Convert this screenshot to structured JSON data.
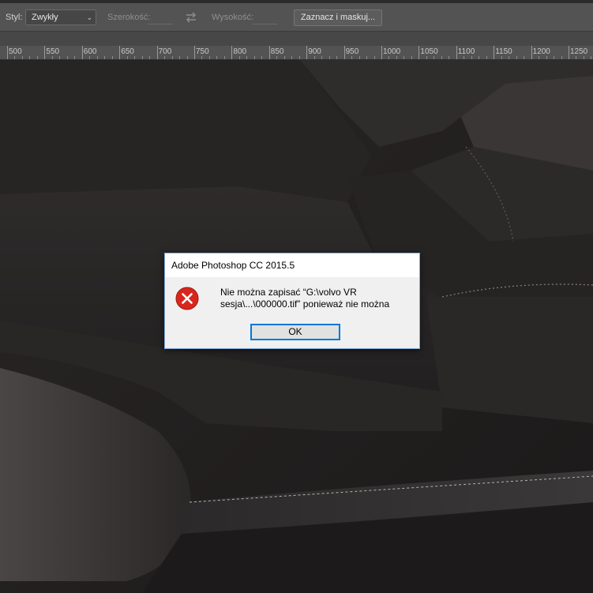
{
  "options_bar": {
    "style_label": "Styl:",
    "style_value": "Zwykły",
    "width_label": "Szerokość:",
    "width_value": "",
    "height_label": "Wysokość:",
    "height_value": "",
    "mask_button_label": "Zaznacz i maskuj..."
  },
  "ruler": {
    "labels": [
      "500",
      "550",
      "600",
      "650",
      "700",
      "750",
      "800",
      "850",
      "900",
      "950",
      "1000",
      "1050",
      "1100",
      "1150",
      "1200",
      "1250"
    ]
  },
  "dialog": {
    "title": "Adobe Photoshop CC 2015.5",
    "message_line1": "Nie można zapisać “G:\\volvo VR",
    "message_line2": "sesja\\...\\000000.tif” ponieważ nie można",
    "ok_label": "OK"
  },
  "colors": {
    "error_red": "#d9261c",
    "focus_blue": "#0078d7",
    "panel_gray": "#535353"
  }
}
